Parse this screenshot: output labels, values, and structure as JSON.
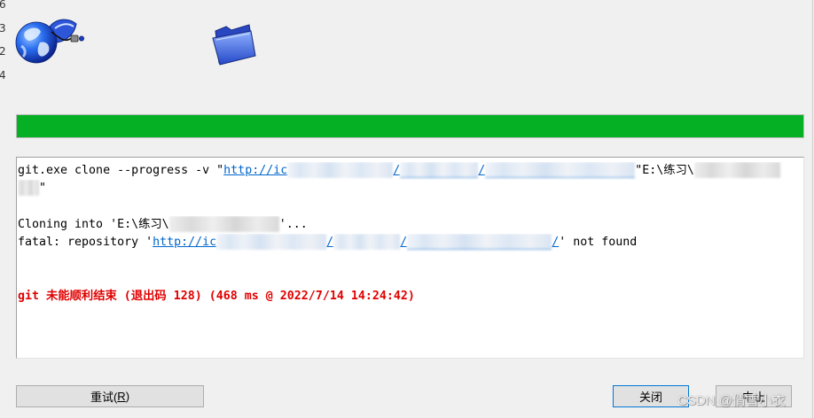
{
  "edge_digits": [
    "6",
    "3",
    "2",
    "4"
  ],
  "icons": {
    "source": "network-globe-icon",
    "target": "folder-icon"
  },
  "progress": {
    "fraction": 1.0,
    "color": "#06b025"
  },
  "colors": {
    "link": "#0066cc",
    "error": "#e00000",
    "focus": "#0078d7"
  },
  "log": {
    "command": {
      "prefix": "git.exe clone --progress -v \"",
      "link_start": "http://ic",
      "slash_1": "/",
      "slash_2": "/",
      "path_start": "\"E:\\练习\\"
    },
    "command_wrap": {
      "suffix": "\""
    },
    "cloning": {
      "prefix": "Cloning into 'E:\\练习\\",
      "suffix": "'..."
    },
    "fatal": {
      "prefix": "fatal: repository '",
      "link_start": "http://ic",
      "slash_1": "/",
      "slash_2": "/",
      "slash_3": "/",
      "suffix": "' not found"
    },
    "error": "git 未能顺利结束 (退出码 128) (468 ms @ 2022/7/14 14:24:42)"
  },
  "buttons": {
    "retry": {
      "label": "重试(",
      "hotkey": "R",
      "label_end": ")"
    },
    "close": {
      "label": "关闭"
    },
    "abort": {
      "label": "中止"
    }
  },
  "watermark": "CSDN @倩雪小衣"
}
